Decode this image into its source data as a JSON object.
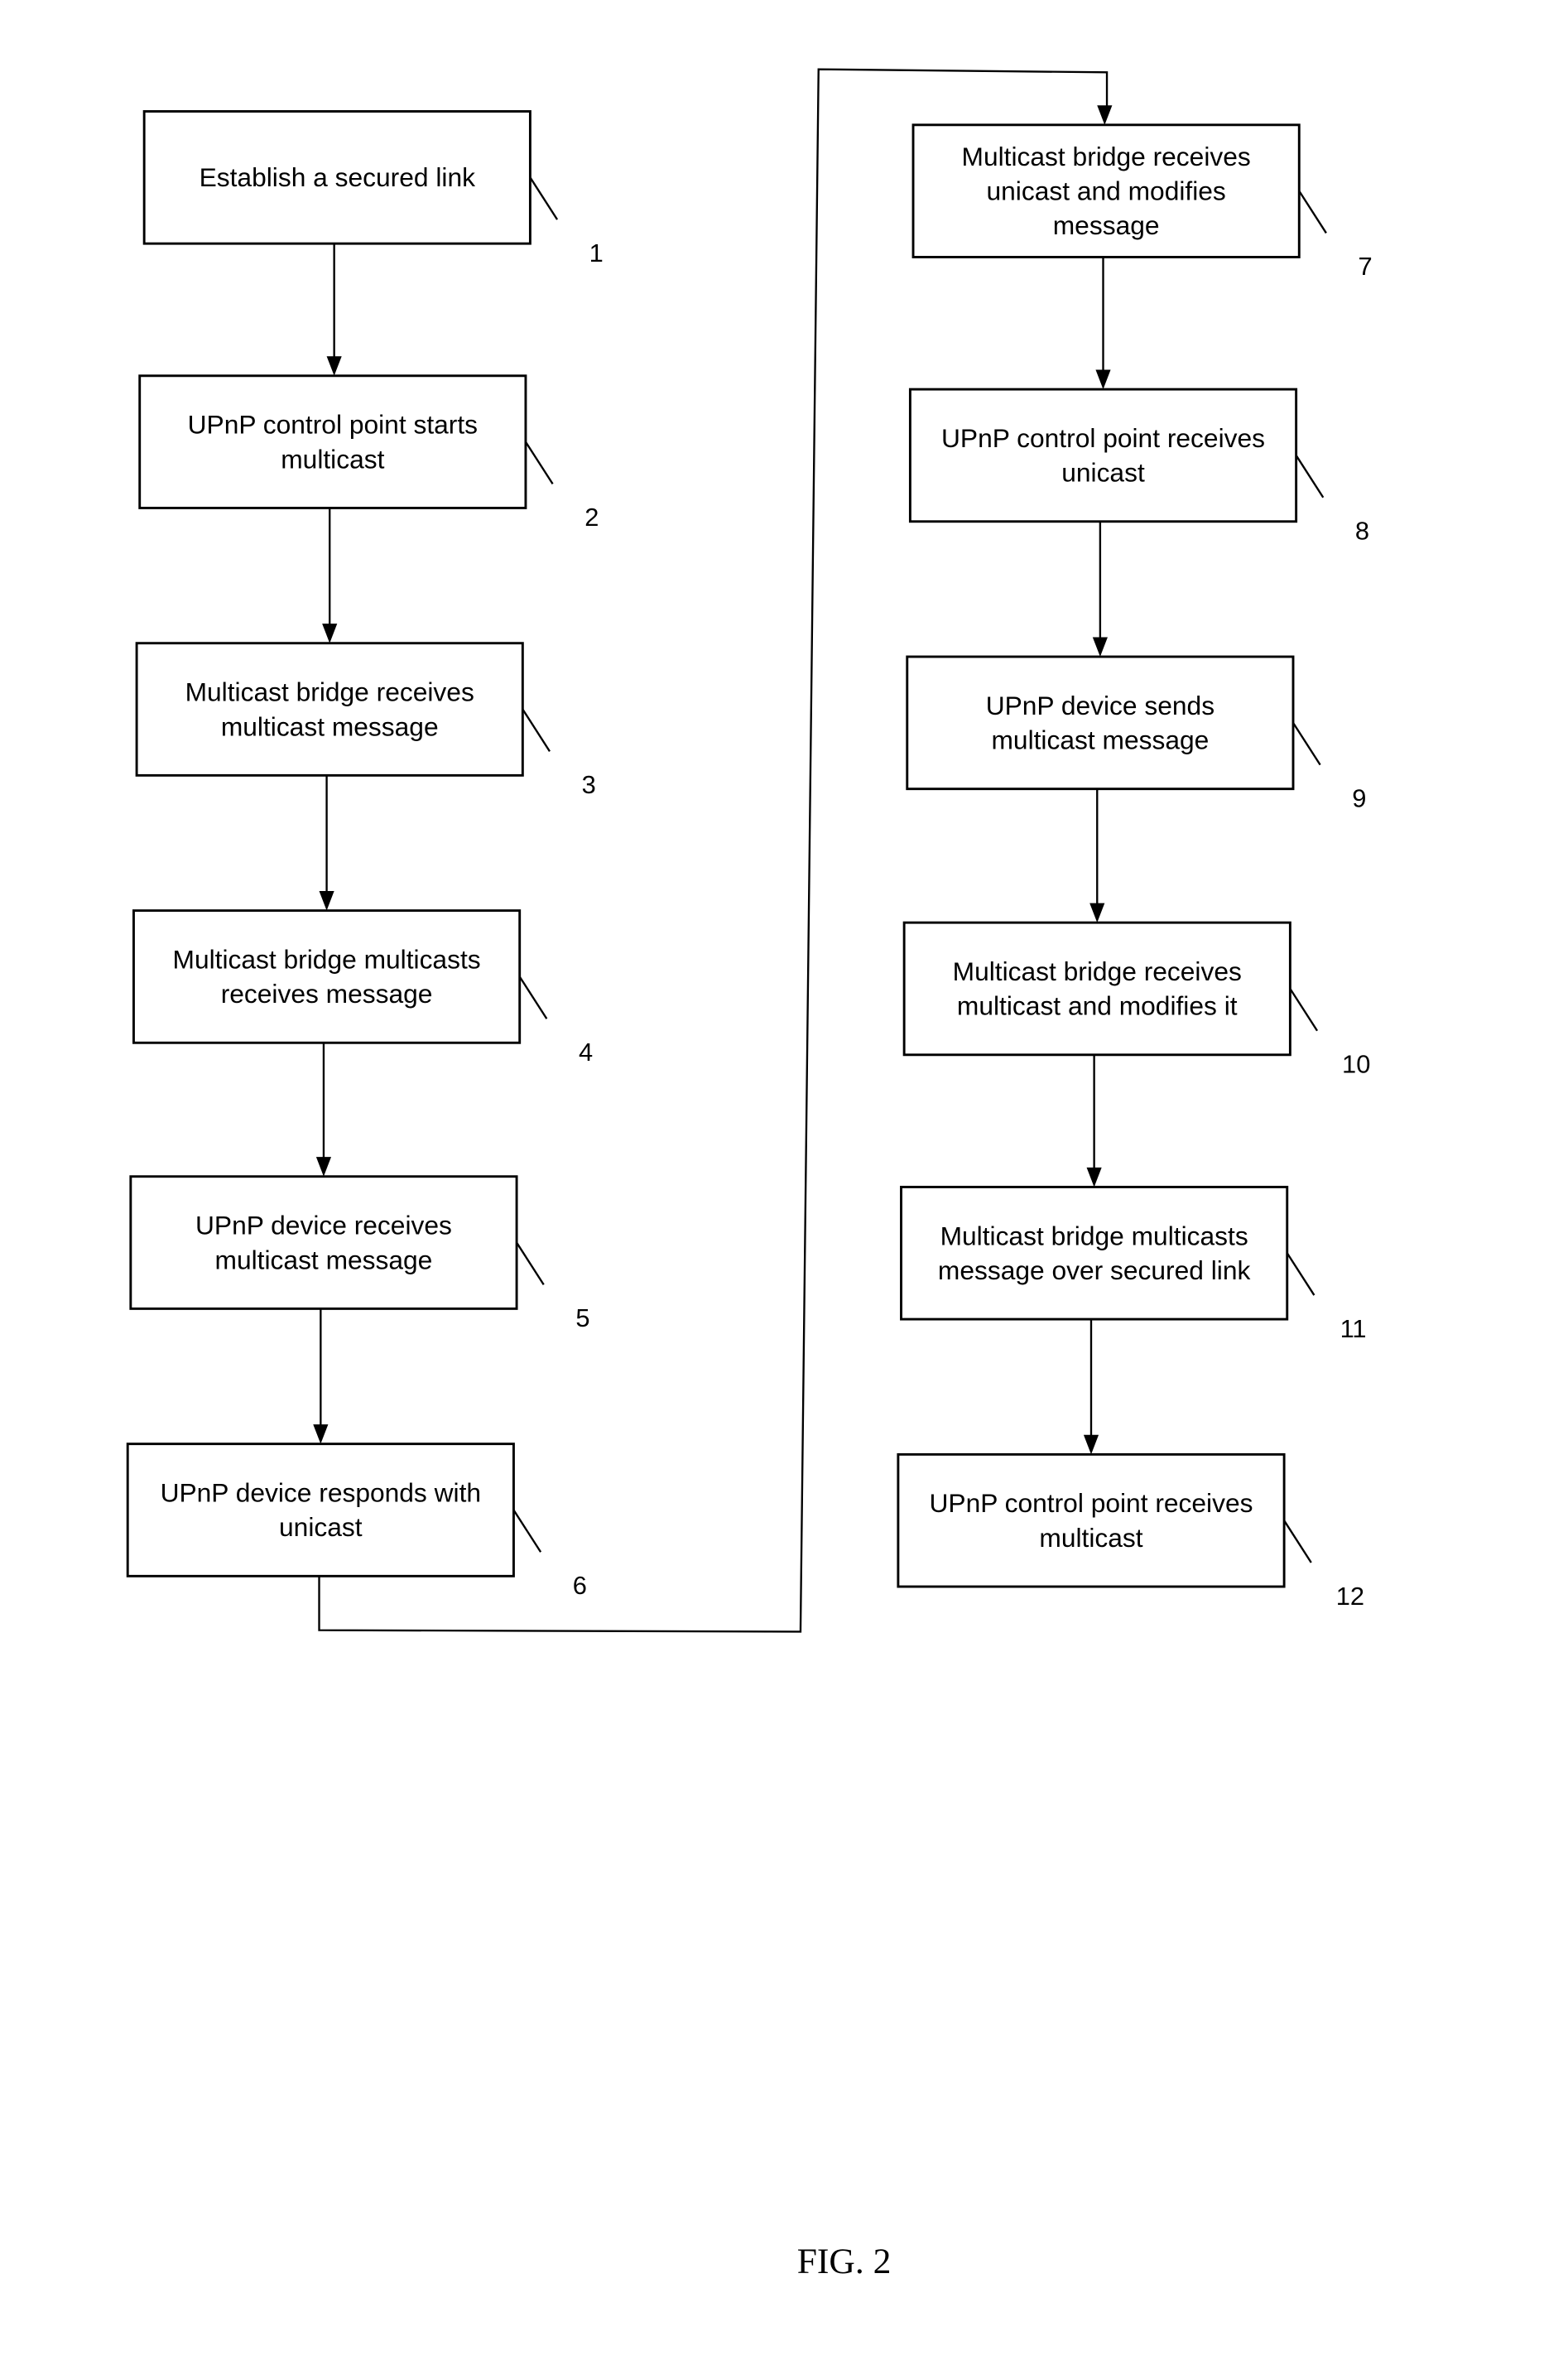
{
  "figure": {
    "caption": "FIG. 2",
    "steps": [
      {
        "ref": "1",
        "lines": [
          "Establish a secured link"
        ]
      },
      {
        "ref": "2",
        "lines": [
          "UPnP control point starts",
          "multicast"
        ]
      },
      {
        "ref": "3",
        "lines": [
          "Multicast bridge receives",
          "multicast message"
        ]
      },
      {
        "ref": "4",
        "lines": [
          "Multicast bridge multicasts",
          "receives message"
        ]
      },
      {
        "ref": "5",
        "lines": [
          "UPnP device receives",
          "multicast message"
        ]
      },
      {
        "ref": "6",
        "lines": [
          "UPnP device responds with",
          "unicast"
        ]
      },
      {
        "ref": "7",
        "lines": [
          "Multicast bridge receives",
          "unicast and modifies",
          "message"
        ]
      },
      {
        "ref": "8",
        "lines": [
          "UPnP control point receives",
          "unicast"
        ]
      },
      {
        "ref": "9",
        "lines": [
          "UPnP device sends",
          "multicast message"
        ]
      },
      {
        "ref": "10",
        "lines": [
          "Multicast bridge receives",
          "multicast and modifies it"
        ]
      },
      {
        "ref": "11",
        "lines": [
          "Multicast bridge multicasts",
          "message over secured link"
        ]
      },
      {
        "ref": "12",
        "lines": [
          "UPnP control point receives",
          "multicast"
        ]
      }
    ]
  }
}
